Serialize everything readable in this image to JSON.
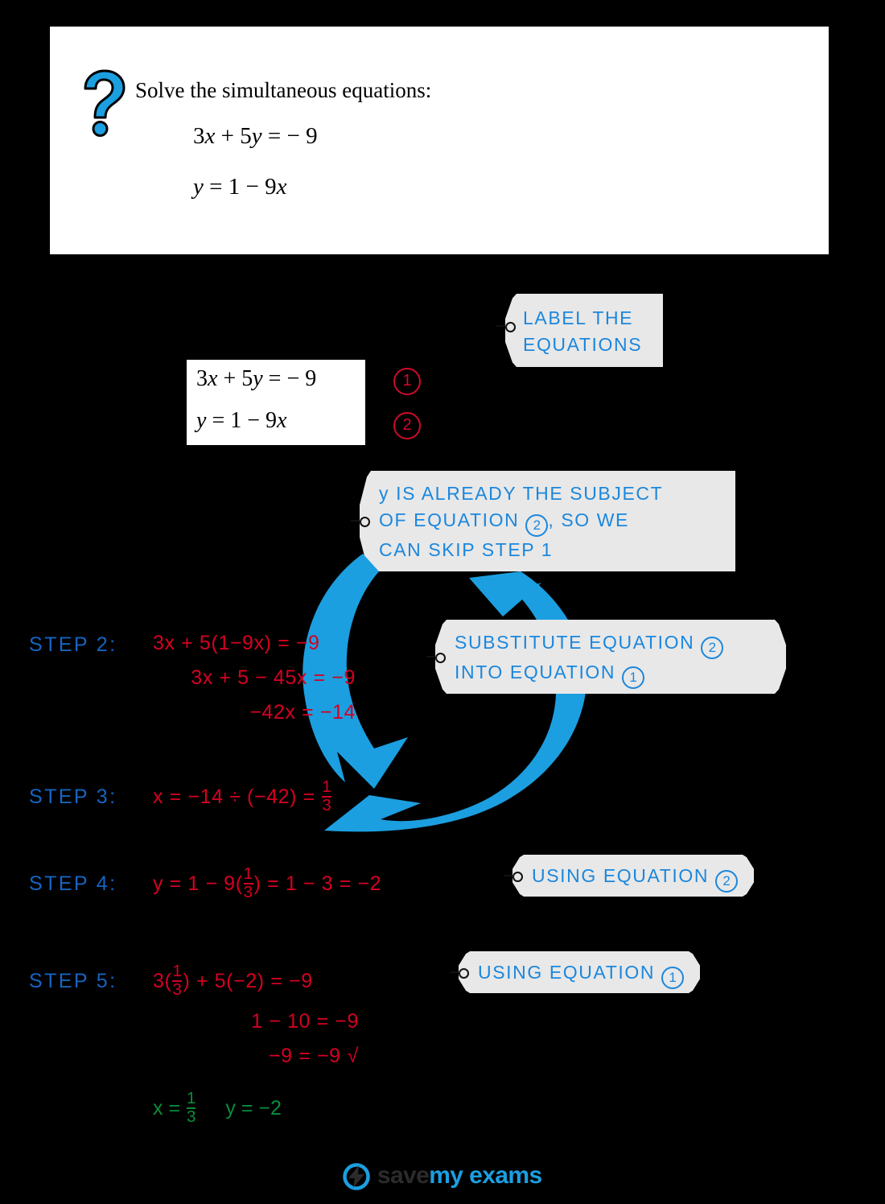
{
  "question": {
    "icon": "question-mark-icon",
    "prompt": "Solve the simultaneous equations:",
    "equations": [
      "3x + 5y = − 9",
      "y = 1 − 9x"
    ]
  },
  "equation_block": {
    "equations": [
      "3x + 5y = − 9",
      "y = 1 − 9x"
    ],
    "labels": [
      "1",
      "2"
    ]
  },
  "callouts": {
    "label_equations": [
      "LABEL  THE",
      "EQUATIONS"
    ],
    "skip_step1": {
      "line1": "y IS  ALREADY  THE  SUBJECT",
      "line2_a": "OF  EQUATION",
      "line2_circle": "2",
      "line2_b": ",  SO  WE",
      "line3": "CAN   SKIP  STEP 1"
    },
    "substitute": {
      "line1_text": "SUBSTITUTE    EQUATION",
      "line1_circle": "2",
      "line2_text": "INTO   EQUATION",
      "line2_circle": "1"
    },
    "using_eq2": {
      "text": "USING   EQUATION",
      "circle": "2"
    },
    "using_eq1": {
      "text": "USING   EQUATION",
      "circle": "1"
    }
  },
  "steps": [
    {
      "label": "STEP  2:",
      "lines": [
        "3x + 5(1−9x) = −9",
        "3x + 5 − 45x = −9",
        "−42x = −14"
      ]
    },
    {
      "label": "STEP  3:",
      "line_prefix": "x = −14 ÷ (−42) = ",
      "fraction": {
        "numerator": "1",
        "denominator": "3"
      }
    },
    {
      "label": "STEP  4:",
      "line_prefix": "y = 1 − 9(",
      "fraction": {
        "numerator": "1",
        "denominator": "3"
      },
      "line_suffix": ") = 1 − 3 = −2"
    },
    {
      "label": "STEP  5:",
      "line1_prefix": "3(",
      "line1_fraction": {
        "numerator": "1",
        "denominator": "3"
      },
      "line1_suffix": ") + 5(−2) = −9",
      "line2": "1 − 10 = −9",
      "line3": "−9 = −9",
      "tick": "√"
    }
  ],
  "final_answer": {
    "x_prefix": "x = ",
    "x_fraction": {
      "numerator": "1",
      "denominator": "3"
    },
    "y_text": "y = −2"
  },
  "footer": {
    "logo_part1": "save",
    "logo_part2": "my exams"
  },
  "colors": {
    "background": "#000000",
    "panel": "#ffffff",
    "blue": "#1b87dd",
    "step_blue": "#1565c0",
    "red": "#d50022",
    "crimson": "#cf0a2c",
    "green": "#0a8c3c",
    "tag_gray": "#e8e8e8",
    "arrow_blue": "#1b9fe0"
  }
}
